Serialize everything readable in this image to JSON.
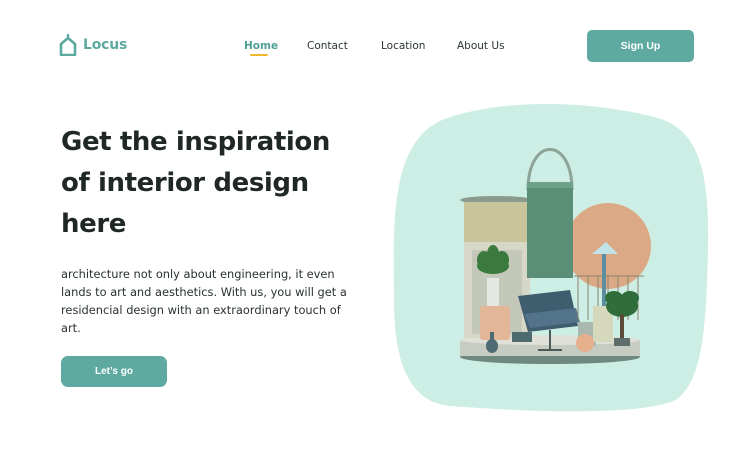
{
  "brand": {
    "name": "Locus",
    "accent": "#5ea9a0",
    "highlight": "#f0b72f",
    "blob": "#cdeee4"
  },
  "nav": {
    "items": [
      {
        "label": "Home",
        "active": true
      },
      {
        "label": "Contact",
        "active": false
      },
      {
        "label": "Location",
        "active": false
      },
      {
        "label": "About Us",
        "active": false
      }
    ]
  },
  "header": {
    "signup_label": "Sign Up"
  },
  "hero": {
    "title_line1": "Get the inspiration",
    "title_line2": "of interior design",
    "title_line3": "here",
    "description": "architecture not only about engineering, it even lands to art and aesthetics. With us, you will get a residencial design with an extraordinary touch of art.",
    "cta_label": "Let’s go"
  },
  "illustration": {
    "icon": "interior-decor-illustration"
  }
}
